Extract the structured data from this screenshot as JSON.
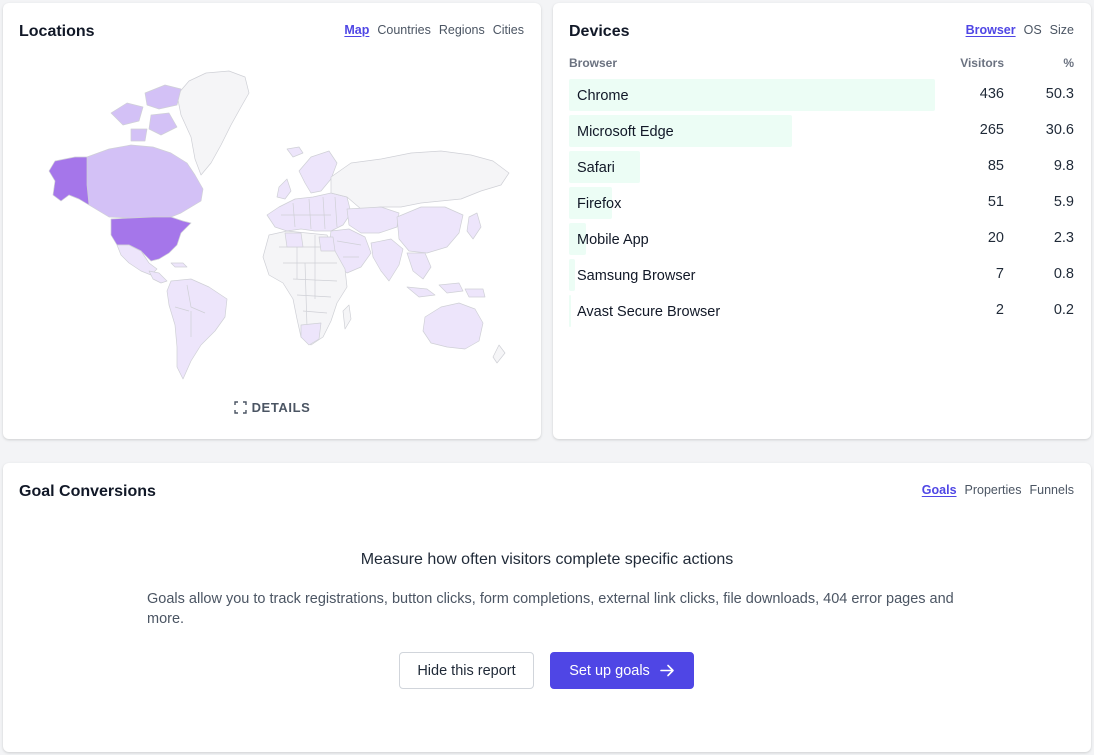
{
  "locations": {
    "title": "Locations",
    "tabs": [
      "Map",
      "Countries",
      "Regions",
      "Cities"
    ],
    "active_tab": "Map",
    "details_label": "DETAILS",
    "details_icon": "expand-icon",
    "map_colors": {
      "high": "#a576ea",
      "medium": "#d3c1f6",
      "low": "#ede5fb",
      "none": "#f5f5f7",
      "border": "#cfd0d6"
    }
  },
  "devices": {
    "title": "Devices",
    "tabs": [
      "Browser",
      "OS",
      "Size"
    ],
    "active_tab": "Browser",
    "columns": {
      "name": "Browser",
      "visitors": "Visitors",
      "percent": "%"
    },
    "rows": [
      {
        "name": "Chrome",
        "visitors": "436",
        "percent": "50.3"
      },
      {
        "name": "Microsoft Edge",
        "visitors": "265",
        "percent": "30.6"
      },
      {
        "name": "Safari",
        "visitors": "85",
        "percent": "9.8"
      },
      {
        "name": "Firefox",
        "visitors": "51",
        "percent": "5.9"
      },
      {
        "name": "Mobile App",
        "visitors": "20",
        "percent": "2.3"
      },
      {
        "name": "Samsung Browser",
        "visitors": "7",
        "percent": "0.8"
      },
      {
        "name": "Avast Secure Browser",
        "visitors": "2",
        "percent": "0.2"
      }
    ],
    "bar_color": "#ecfdf5"
  },
  "goals": {
    "title": "Goal Conversions",
    "tabs": [
      "Goals",
      "Properties",
      "Funnels"
    ],
    "active_tab": "Goals",
    "empty_title": "Measure how often visitors complete specific actions",
    "empty_description": "Goals allow you to track registrations, button clicks, form completions, external link clicks, file downloads, 404 error pages and more.",
    "hide_button": "Hide this report",
    "setup_button": "Set up goals",
    "setup_icon": "arrow-right-icon",
    "accent_color": "#4f46e5"
  }
}
